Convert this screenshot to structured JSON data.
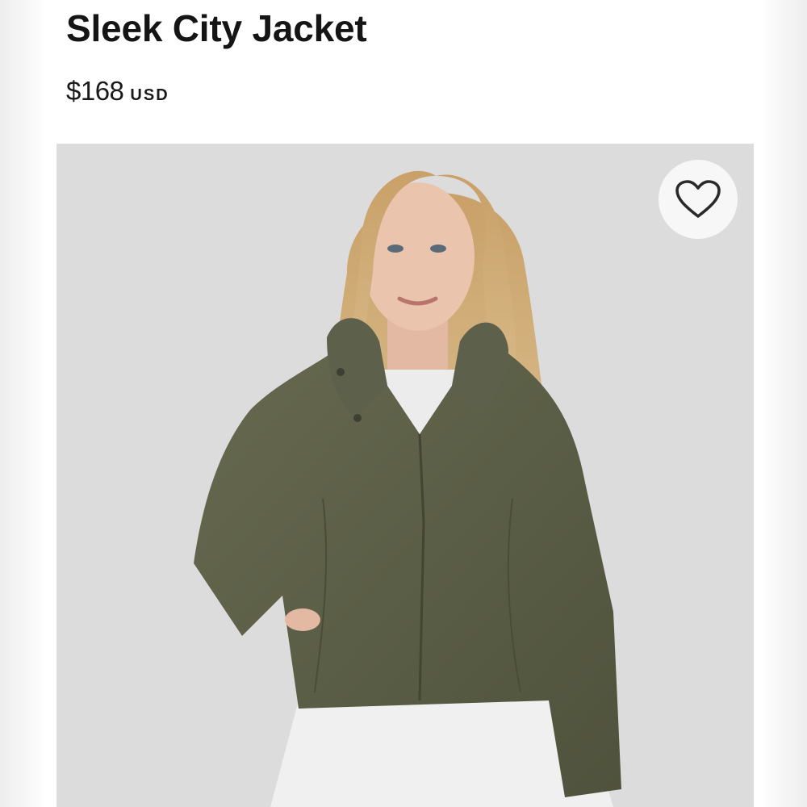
{
  "product": {
    "title": "Sleek City Jacket",
    "price": "$168",
    "currency": "USD"
  },
  "image": {
    "icon": "heart-icon",
    "background_color": "#dcdcdc",
    "jacket_color": "#5e6147"
  }
}
